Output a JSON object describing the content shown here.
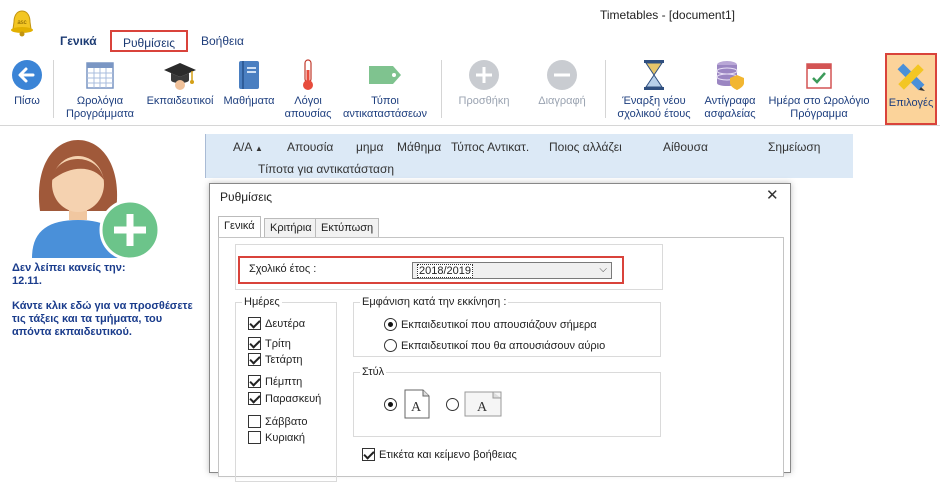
{
  "window": {
    "title": "Timetables - [document1]"
  },
  "menu": {
    "items": [
      "Γενικά",
      "Ρυθμίσεις",
      "Βοήθεια"
    ]
  },
  "ribbon": {
    "back": "Πίσω",
    "timetables": [
      "Ωρολόγια",
      "Προγράμματα"
    ],
    "teachers": "Εκπαιδευτικοί",
    "courses": "Μαθήματα",
    "reasons": [
      "Λόγοι",
      "απουσίας"
    ],
    "subtypes": [
      "Τύποι",
      "αντικαταστάσεων"
    ],
    "add": "Προσθήκη",
    "delete": "Διαγραφή",
    "newyear": [
      "Έναρξη νέου",
      "σχολικού έτους"
    ],
    "backup": [
      "Αντίγραφα",
      "ασφαλείας"
    ],
    "daytt": [
      "Ημέρα στο Ωρολόγιο",
      "Πρόγραμμα"
    ],
    "options": "Επιλογές"
  },
  "leftpanel": {
    "line1": "Δεν λείπει κανείς την:",
    "line2": "12.11.",
    "instructions": "Κάντε κλικ εδώ για να προσθέσετε τις τάξεις και τα τμήματα, του απόντα εκπαιδευτικού."
  },
  "grid": {
    "columns": [
      "Α/Α",
      "Απουσία",
      "μημα",
      "Μάθημα",
      "Τύπος Αντικατ.",
      "Ποιος αλλάζει",
      "Αίθουσα",
      "Σημείωση"
    ],
    "empty_row": "Τίποτα για αντικατάσταση"
  },
  "dialog": {
    "title": "Ρυθμίσεις",
    "tabs": [
      "Γενικά",
      "Κριτήρια",
      "Εκτύπωση"
    ],
    "year_label": "Σχολικό έτος :",
    "year_value": "2018/2019",
    "days_label": "Ημέρες",
    "days": [
      {
        "name": "Δευτέρα",
        "checked": true
      },
      {
        "name": "Τρίτη",
        "checked": true
      },
      {
        "name": "Τετάρτη",
        "checked": true
      },
      {
        "name": "Πέμπτη",
        "checked": true
      },
      {
        "name": "Παρασκευή",
        "checked": true
      },
      {
        "name": "Σάββατο",
        "checked": false
      },
      {
        "name": "Κυριακή",
        "checked": false
      }
    ],
    "startup_label": "Εμφάνιση κατά την εκκίνηση :",
    "startup_options": [
      {
        "label": "Εκπαιδευτικοί που απουσιάζουν σήμερα",
        "selected": true
      },
      {
        "label": "Εκπαιδευτικοί που θα απουσιάσουν αύριο",
        "selected": false
      }
    ],
    "style_label": "Στύλ",
    "style_selected_index": 0,
    "help_label": "Ετικέτα και κείμενο βοήθειας",
    "help_checked": true
  },
  "colors": {
    "accent": "#1d3e7e",
    "highlight": "#d9433b",
    "options_bg": "#fbd39a"
  }
}
